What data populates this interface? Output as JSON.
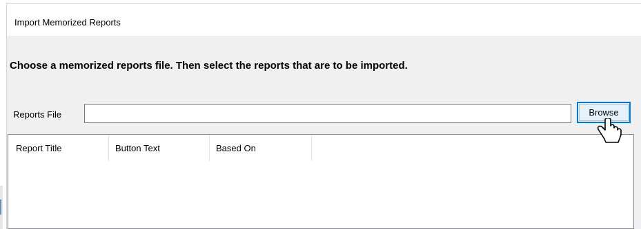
{
  "window": {
    "title": "Import Memorized Reports"
  },
  "instruction": "Choose a memorized reports file.  Then select the reports that are to be imported.",
  "reports_file": {
    "label": "Reports File",
    "value": "",
    "browse_label": "Browse"
  },
  "list": {
    "columns": [
      "Report Title",
      "Button Text",
      "Based On"
    ]
  },
  "colors": {
    "accent": "#0078d7",
    "window_bg": "#f0f0f0",
    "titlebar_bg": "#ffffff"
  },
  "icons": {
    "cursor": "mouse-pointer-icon"
  }
}
